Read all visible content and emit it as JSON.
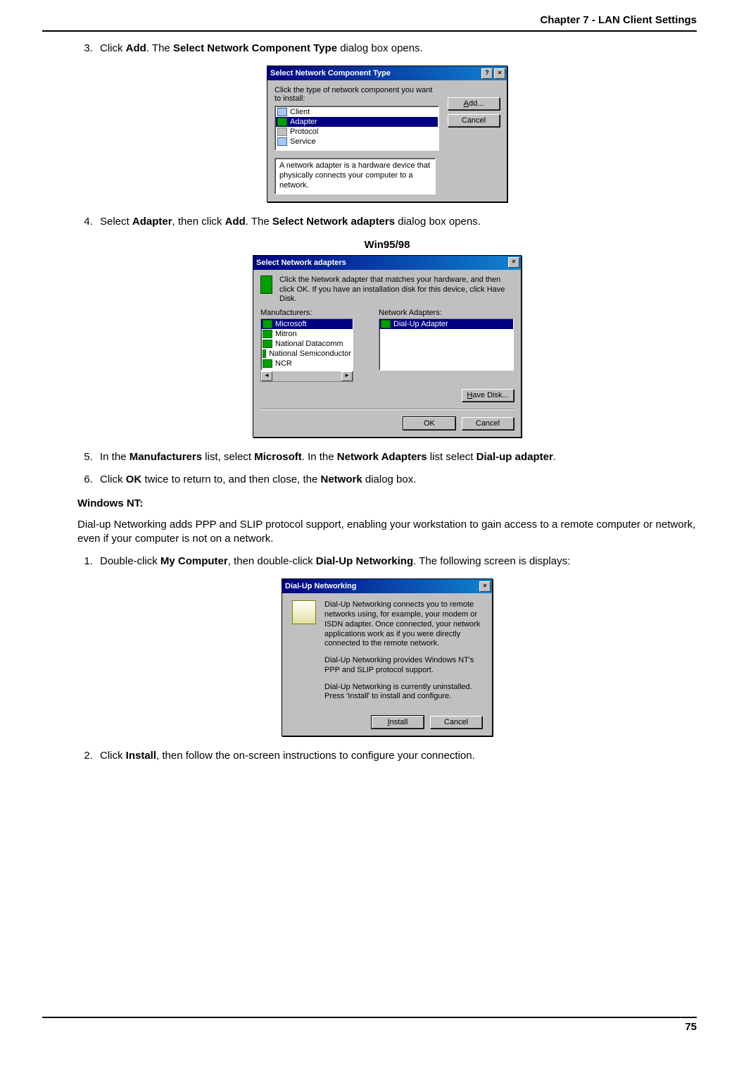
{
  "header": {
    "chapter_title": "Chapter 7 - LAN Client Settings"
  },
  "footer": {
    "page_number": "75"
  },
  "step3": {
    "num": "3.",
    "t0": "Click ",
    "b0": "Add",
    "t1": ". The ",
    "b1": "Select Network Component Type",
    "t2": " dialog box opens."
  },
  "dlg1": {
    "title": "Select Network Component Type",
    "instr": "Click the type of network component you want to install:",
    "items": [
      "Client",
      "Adapter",
      "Protocol",
      "Service"
    ],
    "selected_index": 1,
    "add_btn": "Add...",
    "cancel_btn": "Cancel",
    "help_text": "A network adapter is a hardware device that physically connects your computer to a network."
  },
  "step4": {
    "num": "4.",
    "t0": "Select ",
    "b0": "Adapter",
    "t1": ", then click ",
    "b1": "Add",
    "t2": ". The ",
    "b2": "Select Network adapters",
    "t3": " dialog box opens."
  },
  "dlg2_caption": "Win95/98",
  "dlg2": {
    "title": "Select Network adapters",
    "instr": "Click the Network adapter that matches your hardware, and then click OK. If you have an installation disk for this device, click Have Disk.",
    "manuf_label": "Manufacturers:",
    "adapters_label": "Network Adapters:",
    "manufacturers": [
      "Microsoft",
      "Mitron",
      "National Datacomm",
      "National Semiconductor",
      "NCR"
    ],
    "adapters": [
      "Dial-Up Adapter"
    ],
    "have_disk_btn": "Have Disk...",
    "ok_btn": "OK",
    "cancel_btn": "Cancel"
  },
  "step5": {
    "num": "5.",
    "t0": "In the ",
    "b0": "Manufacturers",
    "t1": " list, select ",
    "b1": "Microsoft",
    "t2": ". In the ",
    "b2": "Network Adapters",
    "t3": " list select ",
    "b3": "Dial-up adapter",
    "t4": "."
  },
  "step6": {
    "num": "6.",
    "t0": "Click ",
    "b0": "OK",
    "t1": " twice to return to, and then close, the ",
    "b1": "Network",
    "t2": " dialog box."
  },
  "nt_heading": "Windows NT:",
  "nt_para": "Dial-up Networking adds PPP and SLIP protocol support, enabling your workstation to gain access to a remote computer or network, even if your computer is not on a network.",
  "nt_step1": {
    "num": "1.",
    "t0": "Double-click ",
    "b0": "My Computer",
    "t1": ", then double-click ",
    "b1": "Dial-Up Networking",
    "t2": ". The following screen is displays:"
  },
  "dlg3": {
    "title": "Dial-Up Networking",
    "p1": "Dial-Up Networking connects you to remote networks using, for example, your modem or ISDN adapter. Once connected, your network applications work as if you were directly connected to the remote network.",
    "p2": "Dial-Up Networking provides Windows NT's PPP and SLIP protocol support.",
    "p3": "Dial-Up Networking is currently uninstalled. Press 'Install' to install and configure.",
    "install_btn": "Install",
    "cancel_btn": "Cancel"
  },
  "nt_step2": {
    "num": "2.",
    "t0": "Click ",
    "b0": "Install",
    "t1": ", then follow the on-screen instructions to configure your connection."
  }
}
